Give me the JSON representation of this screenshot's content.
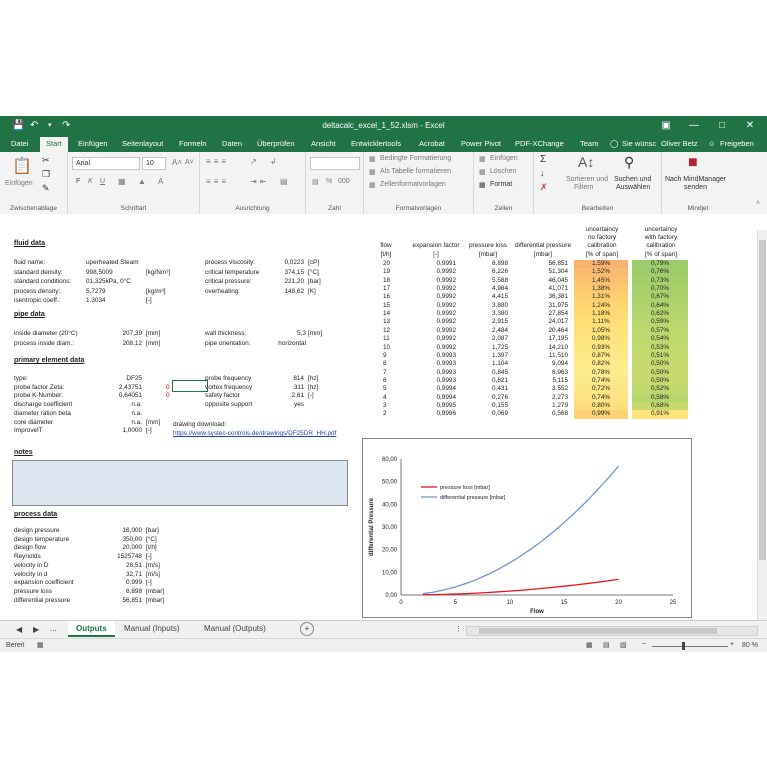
{
  "window": {
    "title": "deltacalc_excel_1_52.xlsm  -  Excel",
    "user": "Oliver Betz",
    "share": "Freigeben",
    "tell_me": "Sie wünsc"
  },
  "tabs": [
    "Datei",
    "Start",
    "Einfügen",
    "Seitenlayout",
    "Formeln",
    "Daten",
    "Überprüfen",
    "Ansicht",
    "Entwicklertools",
    "Acrobat",
    "Power Pivot",
    "PDF-XChange",
    "Team"
  ],
  "ribbon": {
    "paste": "Einfügen",
    "clipboard": "Zwischenablage",
    "font_name": "Arial",
    "font_size": "10",
    "font_group": "Schriftart",
    "bold": "F",
    "italic": "K",
    "underline": "U",
    "alignment_group": "Ausrichtung",
    "number_group": "Zahl",
    "percent": "%",
    "thousands": "000",
    "cond_format": "Bedingte Formatierung",
    "as_table": "Als Tabelle formatieren",
    "cell_styles": "Zellenformatvorlagen",
    "styles_group": "Formatvorlagen",
    "insert": "Einfügen",
    "delete": "Löschen",
    "format": "Format",
    "cells_group": "Zellen",
    "sort_filter_1": "Sortieren und",
    "sort_filter_2": "Filtern",
    "find_select_1": "Suchen und",
    "find_select_2": "Auswählen",
    "editing_group": "Bearbeiten",
    "mindmanager_1": "Nach MindManager",
    "mindmanager_2": "senden",
    "mindjet_group": "Mindjet"
  },
  "sheet": {
    "fluid": {
      "title": "fluid data",
      "rows": [
        {
          "label": "fluid name:",
          "value": "uperheated Steam",
          "unit": ""
        },
        {
          "label": "standard density:",
          "value": "998,5009",
          "unit": "[kg/Nm³]"
        },
        {
          "label": "standard conditions:",
          "value": "01,325kPa, 0°C",
          "unit": ""
        },
        {
          "label": "process density:",
          "value": "5,7279",
          "unit": "[kg/m³]"
        },
        {
          "label": "isentropic coeff.:",
          "value": "1,3034",
          "unit": "[-]"
        }
      ],
      "right": [
        {
          "label": "process viscosity:",
          "value": "0,0223",
          "unit": "[cP]"
        },
        {
          "label": "critical temperature",
          "value": "374,15",
          "unit": "[°C]"
        },
        {
          "label": "critical pressure:",
          "value": "221,20",
          "unit": "[bar]"
        },
        {
          "label": "overheating:",
          "value": "148,62",
          "unit": "[K]"
        }
      ]
    },
    "pipe": {
      "title": "pipe data",
      "rows": [
        {
          "label": "inside diameter (20°C)",
          "value": "207,39",
          "unit": "[mm]"
        },
        {
          "label": "process inside diam.:",
          "value": "208,12",
          "unit": "[mm]"
        }
      ],
      "right": [
        {
          "label": "wall thickness:",
          "value": "5,3",
          "unit": "[mm]"
        },
        {
          "label": "pipe orientation:",
          "value": "horizontal",
          "unit": ""
        }
      ]
    },
    "primary": {
      "title": "primary element data",
      "rows": [
        {
          "label": "type:",
          "value": "DF25",
          "unit": "",
          "flag": ""
        },
        {
          "label": "probe factor Zeta:",
          "value": "2,43751",
          "unit": "",
          "flag": "0"
        },
        {
          "label": "probe K-Number:",
          "value": "0,64051",
          "unit": "",
          "flag": "0"
        },
        {
          "label": "discharge coefficient",
          "value": "n.a.",
          "unit": "",
          "flag": ""
        },
        {
          "label": "diameter ration beta",
          "value": "n.a.",
          "unit": "",
          "flag": ""
        },
        {
          "label": "core diameter",
          "value": "n.a.",
          "unit": "[mm]",
          "flag": ""
        },
        {
          "label": "ImprovelT",
          "value": "1,0000",
          "unit": "[-]",
          "flag": ""
        }
      ],
      "right": [
        {
          "label": "probe frequency",
          "value": "814",
          "unit": "[hz]"
        },
        {
          "label": "vortex frequency",
          "value": "311",
          "unit": "[hz]"
        },
        {
          "label": "safety factor",
          "value": "2,61",
          "unit": "[-]"
        },
        {
          "label": "opposite support",
          "value": "yes",
          "unit": ""
        }
      ],
      "drawing_label": "drawing download:",
      "drawing_link": "https://www.systec-controls.de/drawings/DF25DR_HH.pdf"
    },
    "notes_title": "notes",
    "process": {
      "title": "process data",
      "rows": [
        {
          "label": "design pressure",
          "value": "16,000",
          "unit": "[bar]"
        },
        {
          "label": "design temperature",
          "value": "350,00",
          "unit": "[°C]"
        },
        {
          "label": "design flow",
          "value": "20,000",
          "unit": "[t/h]"
        },
        {
          "label": "Reynolds",
          "value": "1525748",
          "unit": "[-]"
        },
        {
          "label": "velocity in D",
          "value": "28,51",
          "unit": "[m/s]"
        },
        {
          "label": "velocity in d",
          "value": "32,71",
          "unit": "[m/s]"
        },
        {
          "label": "expansion coefficient",
          "value": "0,999",
          "unit": "[-]"
        },
        {
          "label": "pressure loss",
          "value": "6,898",
          "unit": "[mbar]"
        },
        {
          "label": "differential pressure",
          "value": "56,851",
          "unit": "[mbar]"
        }
      ]
    },
    "flow_table": {
      "headers": [
        {
          "l1": "",
          "l2": "",
          "l3": "flow",
          "l4": "[t/h]"
        },
        {
          "l1": "",
          "l2": "",
          "l3": "expansion factor",
          "l4": "[-]"
        },
        {
          "l1": "",
          "l2": "",
          "l3": "pressure loss",
          "l4": "[mbar]"
        },
        {
          "l1": "",
          "l2": "",
          "l3": "differential pressure",
          "l4": "[mbar]"
        },
        {
          "l1": "uncertaincy",
          "l2": "no factory",
          "l3": "calibration",
          "l4": "[% of span]"
        },
        {
          "l1": "uncertaincy",
          "l2": "with factory",
          "l3": "calibration",
          "l4": "[% of span]"
        }
      ],
      "rows": [
        {
          "flow": "20",
          "exp": "0,9991",
          "loss": "6,898",
          "dp": "56,851",
          "u1": "1,59%",
          "u2": "0,79%",
          "c1": "#f8b26f",
          "c2": "#9ccc6b"
        },
        {
          "flow": "19",
          "exp": "0,9992",
          "loss": "6,226",
          "dp": "51,304",
          "u1": "1,52%",
          "u2": "0,76%",
          "c1": "#f9bb6f",
          "c2": "#a0cd6b"
        },
        {
          "flow": "18",
          "exp": "0,9992",
          "loss": "5,588",
          "dp": "46,045",
          "u1": "1,45%",
          "u2": "0,73%",
          "c1": "#fac270",
          "c2": "#a4cf6b"
        },
        {
          "flow": "17",
          "exp": "0,9992",
          "loss": "4,984",
          "dp": "41,071",
          "u1": "1,38%",
          "u2": "0,70%",
          "c1": "#fbc970",
          "c2": "#a8d06c"
        },
        {
          "flow": "16",
          "exp": "0,9992",
          "loss": "4,415",
          "dp": "36,381",
          "u1": "1,31%",
          "u2": "0,67%",
          "c1": "#fcd071",
          "c2": "#acd26c"
        },
        {
          "flow": "15",
          "exp": "0,9992",
          "loss": "3,880",
          "dp": "31,975",
          "u1": "1,24%",
          "u2": "0,64%",
          "c1": "#fdd672",
          "c2": "#b1d36d"
        },
        {
          "flow": "14",
          "exp": "0,9992",
          "loss": "3,380",
          "dp": "27,854",
          "u1": "1,18%",
          "u2": "0,62%",
          "c1": "#fdda73",
          "c2": "#b4d56d"
        },
        {
          "flow": "13",
          "exp": "0,9992",
          "loss": "2,915",
          "dp": "24,017",
          "u1": "1,11%",
          "u2": "0,59%",
          "c1": "#fede76",
          "c2": "#b8d66d"
        },
        {
          "flow": "12",
          "exp": "0,9992",
          "loss": "2,484",
          "dp": "20,464",
          "u1": "1,05%",
          "u2": "0,57%",
          "c1": "#fee17a",
          "c2": "#bbd76e"
        },
        {
          "flow": "11",
          "exp": "0,9992",
          "loss": "2,087",
          "dp": "17,195",
          "u1": "0,98%",
          "u2": "0,54%",
          "c1": "#fee47e",
          "c2": "#bfd86e"
        },
        {
          "flow": "10",
          "exp": "0,9992",
          "loss": "1,725",
          "dp": "14,210",
          "u1": "0,93%",
          "u2": "0,53%",
          "c1": "#fee682",
          "c2": "#c1d96f"
        },
        {
          "flow": "9",
          "exp": "0,9993",
          "loss": "1,397",
          "dp": "11,510",
          "u1": "0,87%",
          "u2": "0,51%",
          "c1": "#fee886",
          "c2": "#c4da6f"
        },
        {
          "flow": "8",
          "exp": "0,9993",
          "loss": "1,104",
          "dp": "9,094",
          "u1": "0,82%",
          "u2": "0,50%",
          "c1": "#feea89",
          "c2": "#c6da6f"
        },
        {
          "flow": "7",
          "exp": "0,9993",
          "loss": "0,845",
          "dp": "6,963",
          "u1": "0,78%",
          "u2": "0,50%",
          "c1": "#feeb8c",
          "c2": "#c6da6f"
        },
        {
          "flow": "6",
          "exp": "0,9993",
          "loss": "0,621",
          "dp": "5,115",
          "u1": "0,74%",
          "u2": "0,50%",
          "c1": "#fee98a",
          "c2": "#c6da6f"
        },
        {
          "flow": "5",
          "exp": "0,9994",
          "loss": "0,431",
          "dp": "3,552",
          "u1": "0,72%",
          "u2": "0,52%",
          "c1": "#fee686",
          "c2": "#bfd86e"
        },
        {
          "flow": "4",
          "exp": "0,9994",
          "loss": "0,276",
          "dp": "2,273",
          "u1": "0,74%",
          "u2": "0,58%",
          "c1": "#fee383",
          "c2": "#b6d56d"
        },
        {
          "flow": "3",
          "exp": "0,9995",
          "loss": "0,155",
          "dp": "1,279",
          "u1": "0,80%",
          "u2": "0,68%",
          "c1": "#fdde7e",
          "c2": "#c6da6f"
        },
        {
          "flow": "2",
          "exp": "0,9996",
          "loss": "0,069",
          "dp": "0,568",
          "u1": "0,99%",
          "u2": "0,91%",
          "c1": "#fdd274",
          "c2": "#fee27a"
        }
      ]
    }
  },
  "chart_data": {
    "type": "line",
    "xlabel": "Flow",
    "ylabel": "differential Pressure",
    "xlim": [
      0,
      25
    ],
    "ylim": [
      0,
      60
    ],
    "xticks": [
      "0",
      "5",
      "10",
      "15",
      "20",
      "25"
    ],
    "yticks": [
      "0,00",
      "10,00",
      "20,00",
      "30,00",
      "40,00",
      "50,00",
      "60,00"
    ],
    "legend_position": "top-left",
    "x": [
      2,
      3,
      4,
      5,
      6,
      7,
      8,
      9,
      10,
      11,
      12,
      13,
      14,
      15,
      16,
      17,
      18,
      19,
      20
    ],
    "series": [
      {
        "name": "pressure loss [mbar]",
        "color": "#e8141c",
        "values": [
          0.069,
          0.155,
          0.276,
          0.431,
          0.621,
          0.845,
          1.104,
          1.397,
          1.725,
          2.087,
          2.484,
          2.915,
          3.38,
          3.88,
          4.415,
          4.984,
          5.588,
          6.226,
          6.898
        ]
      },
      {
        "name": "differential pressure [mbar]",
        "color": "#6f96d0",
        "values": [
          0.568,
          1.279,
          2.273,
          3.552,
          5.115,
          6.963,
          9.094,
          11.51,
          14.21,
          17.195,
          20.464,
          24.017,
          27.854,
          31.975,
          36.381,
          41.071,
          46.045,
          51.304,
          56.851
        ]
      }
    ]
  },
  "sheet_tabs": {
    "more": "...",
    "active": "Outputs",
    "tabs": [
      "Manual (Inputs)",
      "Manual (Outputs)"
    ],
    "add": "+"
  },
  "status": {
    "ready": "Bereit",
    "zoom": "80 %"
  }
}
